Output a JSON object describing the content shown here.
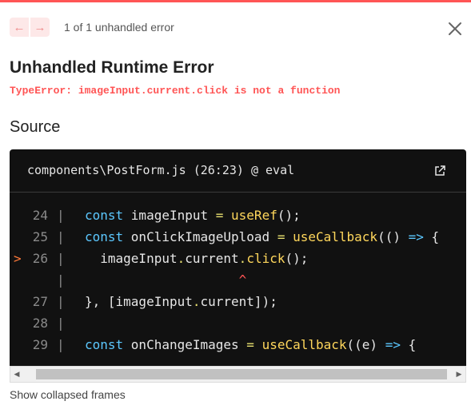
{
  "nav": {
    "prev_icon": "arrow-left-icon",
    "next_icon": "arrow-right-icon",
    "prev_glyph": "←",
    "next_glyph": "→",
    "count_text": "1 of 1 unhandled error"
  },
  "close_icon": "close-icon",
  "error": {
    "title": "Unhandled Runtime Error",
    "message": "TypeError: imageInput.current.click is not a function"
  },
  "source": {
    "heading": "Source",
    "file_label": "components\\PostForm.js (26:23) @ eval",
    "open_icon": "external-link-icon",
    "lines": [
      {
        "num": "24",
        "marker": "",
        "gutter": "|",
        "tokens": [
          {
            "t": "const ",
            "c": "k"
          },
          {
            "t": "imageInput ",
            "c": "p"
          },
          {
            "t": "= ",
            "c": "o"
          },
          {
            "t": "useRef",
            "c": "f"
          },
          {
            "t": "();",
            "c": "p"
          }
        ]
      },
      {
        "num": "25",
        "marker": "",
        "gutter": "|",
        "tokens": [
          {
            "t": "const ",
            "c": "k"
          },
          {
            "t": "onClickImageUpload ",
            "c": "p"
          },
          {
            "t": "= ",
            "c": "o"
          },
          {
            "t": "useCallback",
            "c": "f"
          },
          {
            "t": "(() ",
            "c": "p"
          },
          {
            "t": "=> ",
            "c": "k"
          },
          {
            "t": "{",
            "c": "p"
          }
        ]
      },
      {
        "num": "26",
        "marker": ">",
        "gutter": "|",
        "tokens": [
          {
            "t": "  imageInput",
            "c": "p"
          },
          {
            "t": ".",
            "c": "o"
          },
          {
            "t": "current",
            "c": "p"
          },
          {
            "t": ".",
            "c": "o"
          },
          {
            "t": "click",
            "c": "f"
          },
          {
            "t": "();",
            "c": "p"
          }
        ]
      },
      {
        "num": "",
        "marker": "",
        "gutter": "|",
        "tokens": [
          {
            "t": "                    ",
            "c": "p"
          },
          {
            "t": "^",
            "c": "caret"
          }
        ]
      },
      {
        "num": "27",
        "marker": "",
        "gutter": "|",
        "tokens": [
          {
            "t": "}, [imageInput",
            "c": "p"
          },
          {
            "t": ".",
            "c": "o"
          },
          {
            "t": "current]);",
            "c": "p"
          }
        ]
      },
      {
        "num": "28",
        "marker": "",
        "gutter": "|",
        "tokens": []
      },
      {
        "num": "29",
        "marker": "",
        "gutter": "|",
        "tokens": [
          {
            "t": "const ",
            "c": "k"
          },
          {
            "t": "onChangeImages ",
            "c": "p"
          },
          {
            "t": "= ",
            "c": "o"
          },
          {
            "t": "useCallback",
            "c": "f"
          },
          {
            "t": "((e) ",
            "c": "p"
          },
          {
            "t": "=> ",
            "c": "k"
          },
          {
            "t": "{",
            "c": "p"
          }
        ]
      }
    ]
  },
  "scrollbar": {
    "left_icon": "scroll-left-arrow-icon",
    "right_icon": "scroll-right-arrow-icon",
    "left_glyph": "◀",
    "right_glyph": "▶"
  },
  "footer": {
    "collapsed_label": "Show collapsed frames"
  },
  "colors": {
    "accent": "#ff5555",
    "code_bg": "#111111",
    "keyword": "#5cc8ff",
    "function": "#ffd75c"
  }
}
